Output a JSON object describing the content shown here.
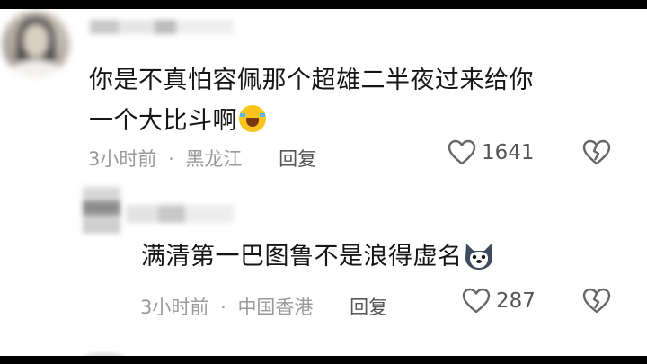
{
  "comments": [
    {
      "text_line1": "你是不真怕容佩那个超雄二半夜过来给你",
      "text_line2": "一个大比斗啊",
      "emoji": "laughing-crying-emoji",
      "time": "3小时前",
      "separator": "·",
      "location": "黑龙江",
      "reply_label": "回复",
      "like_count": "1641"
    },
    {
      "text": "满清第一巴图鲁不是浪得虚名",
      "emoji": "husky-dog-emoji",
      "time": "3小时前",
      "separator": "·",
      "location": "中国香港",
      "reply_label": "回复",
      "like_count": "287"
    }
  ],
  "icons": {
    "like": "heart-outline-icon",
    "dislike": "broken-heart-icon"
  },
  "colors": {
    "text": "#161616",
    "meta": "#9a9a9a",
    "background": "#ffffff"
  }
}
